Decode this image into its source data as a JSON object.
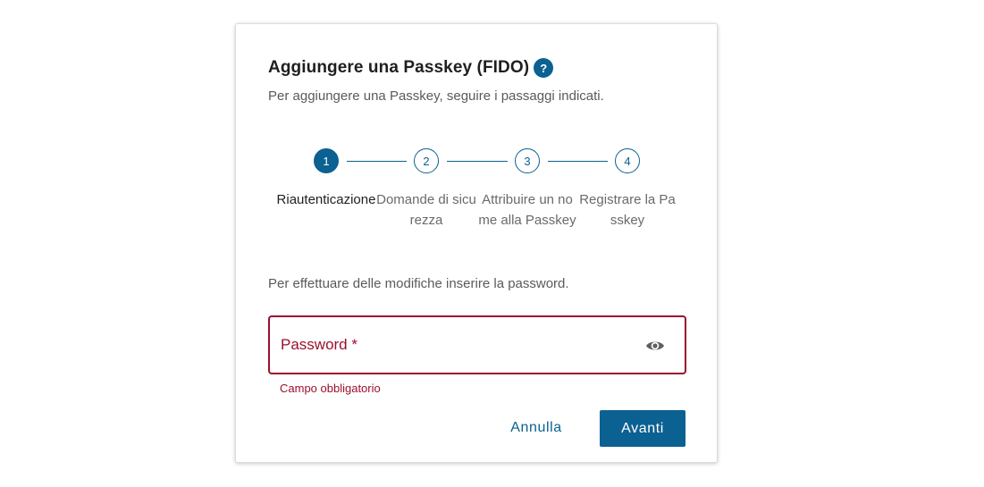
{
  "dialog": {
    "title": "Aggiungere una Passkey (FIDO)",
    "help_icon_glyph": "?",
    "subtitle": "Per aggiungere una Passkey, seguire i passaggi indicati."
  },
  "stepper": {
    "active_step": 1,
    "steps": [
      {
        "number": "1",
        "label": "Riautenticazione"
      },
      {
        "number": "2",
        "label": "Domande di sicurezza"
      },
      {
        "number": "3",
        "label": "Attribuire un nome alla Passkey"
      },
      {
        "number": "4",
        "label": "Registrare la Passkey"
      }
    ]
  },
  "form": {
    "instruction": "Per effettuare delle modifiche inserire la password.",
    "password_label": "Password *",
    "password_value": "",
    "visibility_icon": "eye-icon",
    "error": "Campo obbligatorio"
  },
  "actions": {
    "cancel_label": "Annulla",
    "next_label": "Avanti"
  },
  "colors": {
    "primary": "#0b6191",
    "error": "#9b0f2c"
  }
}
